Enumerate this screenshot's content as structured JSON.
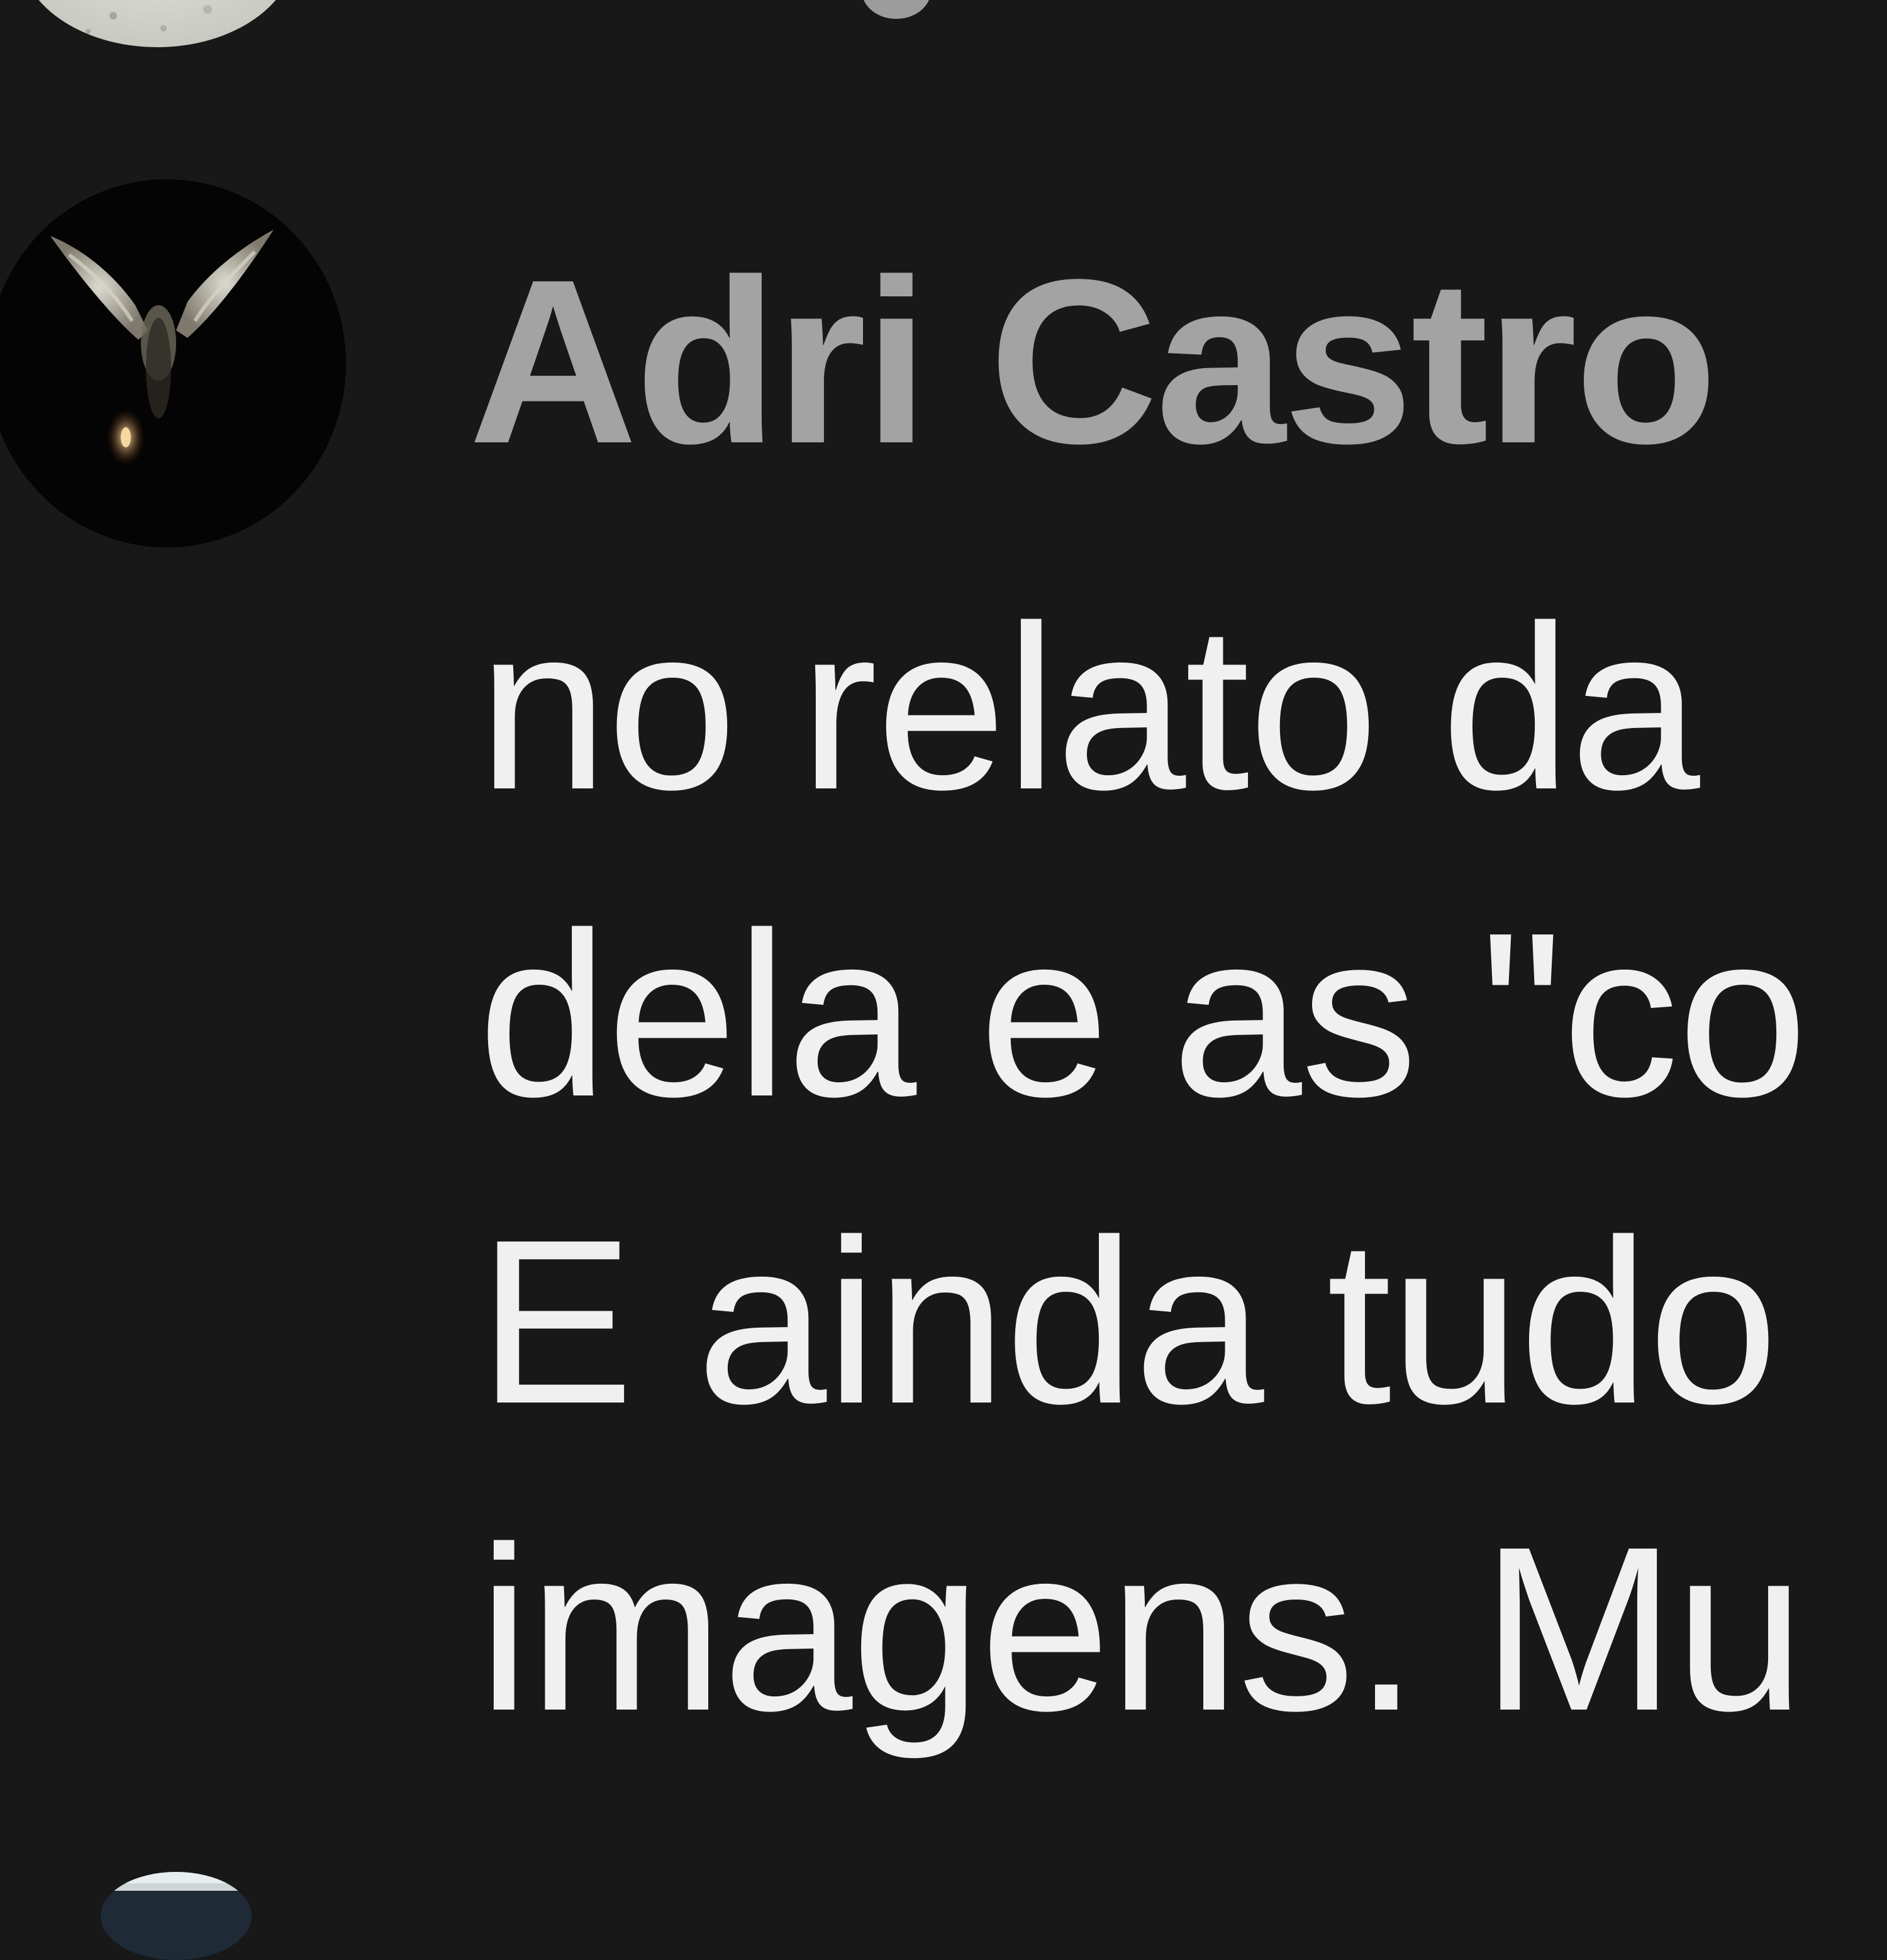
{
  "comment": {
    "author": "Adri Castro",
    "body_lines": [
      "no relato da",
      "dela e as \"co",
      "E ainda tudo",
      "imagens. Mu"
    ]
  },
  "colors": {
    "background": "#181818",
    "author_text": "#a3a3a3",
    "body_text": "#f0f0f0"
  },
  "icons": {
    "main_avatar": "angel-wings-icon",
    "previous_avatar": "grey-texture-avatar",
    "next_avatar": "partial-avatar"
  }
}
